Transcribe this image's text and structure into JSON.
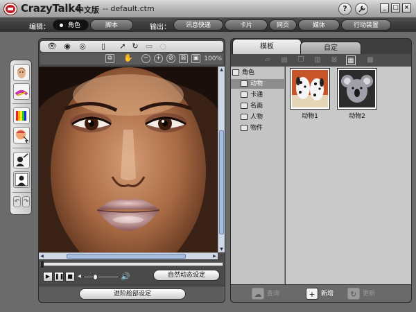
{
  "title_bar": {
    "app_name": "CrazyTalk4",
    "edition": "中文版",
    "filename": "-- default.ctm",
    "help_label": "?",
    "buttons": [
      "_",
      "□",
      "×"
    ]
  },
  "menu_bar": {
    "edit_label": "编辑：",
    "edit_tabs": [
      "角色",
      "脚本"
    ],
    "output_label": "输出：",
    "output_tabs": [
      "讯息快递",
      "卡片",
      "网页",
      "媒体",
      "行动装置"
    ],
    "active_tab": "角色"
  },
  "viewer": {
    "zoom": "100%",
    "auto_motion_label": "自然动态设定",
    "fit_face_label": "进阶脸部设定",
    "volume_fraction": 0.3
  },
  "library": {
    "tabs": [
      "模板",
      "自定"
    ],
    "active_tab": "模板",
    "tree": {
      "root": "角色",
      "children": [
        "动物",
        "卡通",
        "名画",
        "人物",
        "物件"
      ],
      "selected": "动物"
    },
    "items": [
      {
        "caption": "动物1",
        "icon": "dalmatian-dogs-thumbnail"
      },
      {
        "caption": "动物2",
        "icon": "koala-thumbnail"
      }
    ],
    "footer": {
      "query_label": "查询",
      "add_label": "新增",
      "update_label": "更新"
    }
  },
  "colors": {
    "brand_red": "#c8161d",
    "panel_dark": "#3e3e3e",
    "scrollbar": "#a9bddc"
  }
}
